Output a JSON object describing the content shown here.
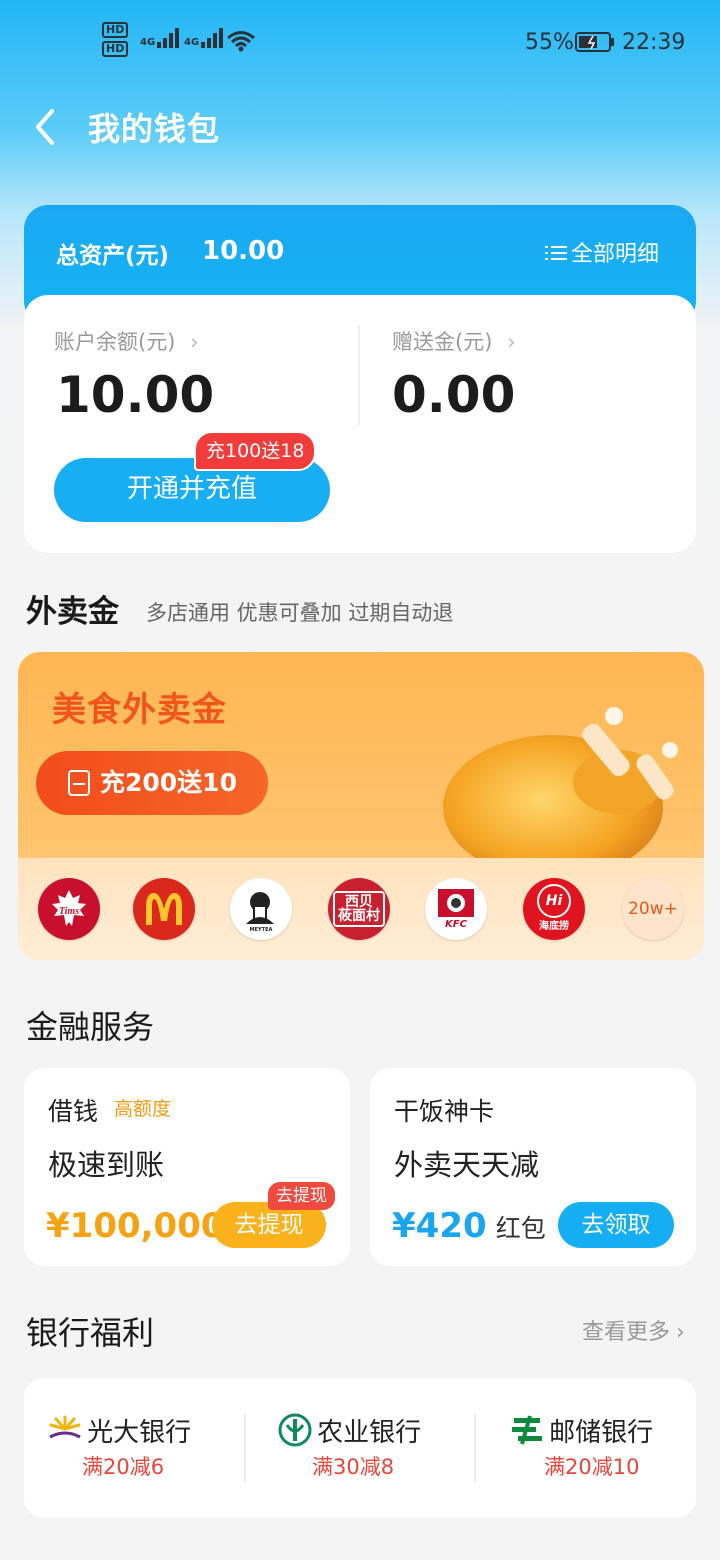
{
  "status_bar": {
    "battery": "55%",
    "time": "22:39",
    "hd1": "HD",
    "hd2": "HD",
    "net1": "4G",
    "net2": "4G"
  },
  "header": {
    "title": "我的钱包"
  },
  "assets": {
    "total_label": "总资产(元)",
    "total_value": "10.00",
    "detail_label": "全部明细",
    "balance_label": "账户余额(元)",
    "balance_value": "10.00",
    "gift_label": "赠送金(元)",
    "gift_value": "0.00",
    "recharge_label": "开通并充值",
    "promo_badge": "充100送18"
  },
  "takeaway": {
    "title": "外卖金",
    "subtitle": "多店通用 优惠可叠加 过期自动退",
    "card_title": "美食外卖金",
    "card_button": "充200送10",
    "brands": [
      {
        "name": "Tims",
        "color": "#c8102e"
      },
      {
        "name": "M",
        "color": "#da291c"
      },
      {
        "name": "MEYTEA",
        "color": "#ffffff"
      },
      {
        "name": "西贝\n莜面村",
        "color": "#c8202f"
      },
      {
        "name": "KFC",
        "color": "#ffffff"
      },
      {
        "name": "海底捞",
        "color": "#e0141e"
      }
    ],
    "more_count": "20w+"
  },
  "finance": {
    "title": "金融服务",
    "loan": {
      "title": "借钱",
      "tag": "高额度",
      "headline": "极速到账",
      "amount": "¥100,000",
      "button": "去提现",
      "badge": "去提现"
    },
    "card": {
      "title": "干饭神卡",
      "headline": "外卖天天减",
      "amount": "¥420",
      "unit": "红包",
      "button": "去领取"
    }
  },
  "bank": {
    "title": "银行福利",
    "more": "查看更多",
    "items": [
      {
        "name": "光大银行",
        "offer": "满20减6"
      },
      {
        "name": "农业银行",
        "offer": "满30减8"
      },
      {
        "name": "邮储银行",
        "offer": "满20减10"
      }
    ]
  }
}
